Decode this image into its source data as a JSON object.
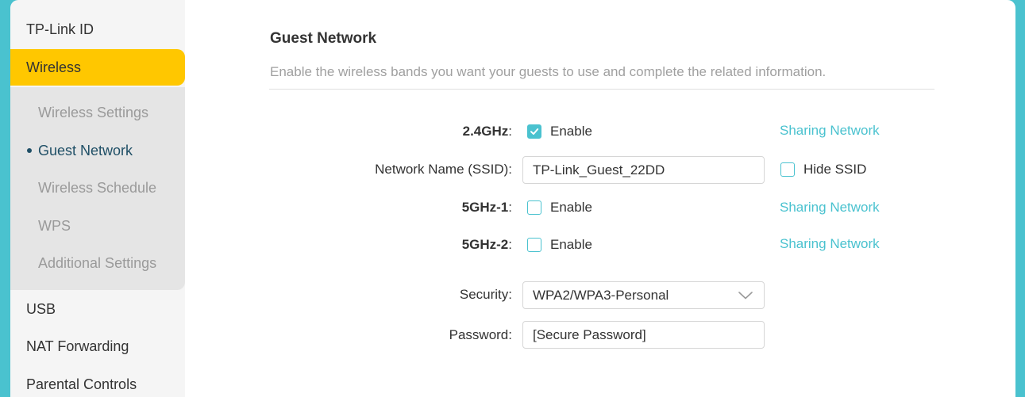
{
  "sidebar": {
    "items": [
      {
        "label": "TP-Link ID"
      },
      {
        "label": "Wireless"
      },
      {
        "label": "USB"
      },
      {
        "label": "NAT Forwarding"
      },
      {
        "label": "Parental Controls"
      }
    ],
    "submenu": [
      {
        "label": "Wireless Settings"
      },
      {
        "label": "Guest Network"
      },
      {
        "label": "Wireless Schedule"
      },
      {
        "label": "WPS"
      },
      {
        "label": "Additional Settings"
      }
    ]
  },
  "guest": {
    "title": "Guest Network",
    "description": "Enable the wireless bands you want your guests to use and complete the related information.",
    "band24": {
      "label": "2.4GHz",
      "colon": ":",
      "enable": "Enable",
      "checked": true,
      "sharing": "Sharing Network"
    },
    "ssid": {
      "label": "Network Name (SSID):",
      "value": "TP-Link_Guest_22DD",
      "hide_label": "Hide SSID"
    },
    "band5_1": {
      "label": "5GHz-1",
      "colon": ":",
      "enable": "Enable",
      "checked": false,
      "sharing": "Sharing Network"
    },
    "band5_2": {
      "label": "5GHz-2",
      "colon": ":",
      "enable": "Enable",
      "checked": false,
      "sharing": "Sharing Network"
    },
    "security": {
      "label": "Security:",
      "value": "WPA2/WPA3-Personal"
    },
    "password": {
      "label": "Password:",
      "value": "[Secure Password]"
    }
  },
  "colors": {
    "accent": "#4ac2cf",
    "active_menu": "#ffc700"
  }
}
